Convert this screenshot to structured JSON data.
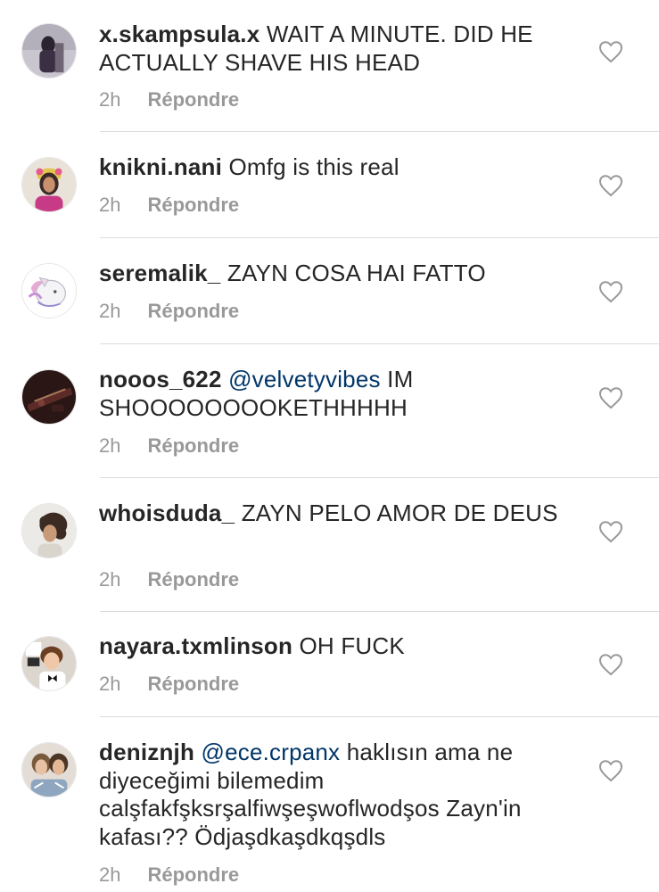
{
  "reply_label": "Répondre",
  "comments": [
    {
      "username": "x.skampsula.x",
      "mention": "",
      "text": "WAIT A MINUTE. DID HE ACTUALLY SHAVE HIS HEAD",
      "time": "2h"
    },
    {
      "username": "knikni.nani",
      "mention": "",
      "text": "Omfg is this real",
      "time": "2h"
    },
    {
      "username": "seremalik_",
      "mention": "",
      "text": "ZAYN COSA HAI FATTO",
      "time": "2h"
    },
    {
      "username": "nooos_622",
      "mention": "@velvetyvibes",
      "text": "IM SHOOOOOOOOKETHHHHH",
      "time": "2h"
    },
    {
      "username": "whoisduda_",
      "mention": "",
      "text": "ZAYN PELO AMOR DE DEUS",
      "time": "2h"
    },
    {
      "username": "nayara.txmlinson",
      "mention": "",
      "text": "OH FUCK",
      "time": "2h"
    },
    {
      "username": "deniznjh",
      "mention": "@ece.crpanx",
      "text": "haklısın ama ne diyeceğimi bilemedim calşfakfşksrşalfiwşeşwoflwodşos Zayn'in kafası?? Ödjaşdkaşdkqşdls",
      "time": "2h"
    }
  ],
  "icons": {
    "like": "heart-outline-icon",
    "avatar": "profile-picture"
  },
  "colors": {
    "text": "#262626",
    "meta": "#999999",
    "mention": "#003569",
    "divider": "#dbdbdb"
  }
}
